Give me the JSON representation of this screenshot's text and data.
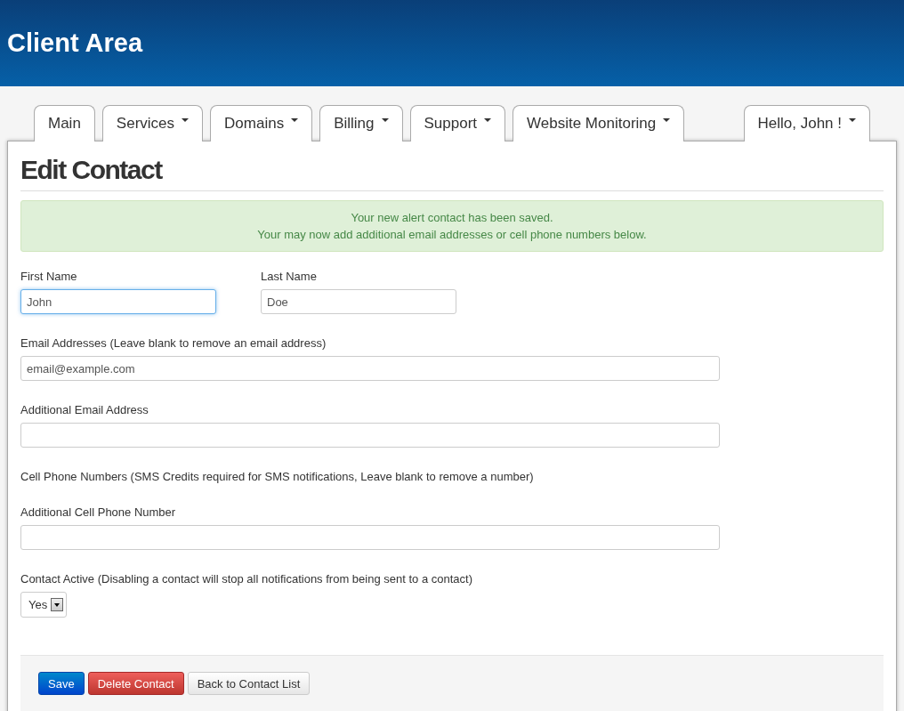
{
  "header": {
    "title": "Client Area"
  },
  "tabs": [
    {
      "label": "Main",
      "dropdown": false
    },
    {
      "label": "Services",
      "dropdown": true
    },
    {
      "label": "Domains",
      "dropdown": true
    },
    {
      "label": "Billing",
      "dropdown": true
    },
    {
      "label": "Support",
      "dropdown": true
    },
    {
      "label": "Website Monitoring",
      "dropdown": true
    }
  ],
  "user_menu": {
    "label": "Hello, John !",
    "dropdown": true
  },
  "page_title": "Edit Contact",
  "alert": {
    "lines": [
      "Your new alert contact has been saved.",
      "Your may now add additional email addresses or cell phone numbers below."
    ]
  },
  "name_fields": [
    {
      "label": "First Name",
      "value": "John",
      "focused": true
    },
    {
      "label": "Last Name",
      "value": "Doe",
      "focused": false
    }
  ],
  "sections": [
    {
      "kind": "field",
      "label": "Email Addresses (Leave blank to remove an email address)",
      "value": "email@example.com"
    },
    {
      "kind": "field",
      "label": "Additional Email Address"
    },
    {
      "kind": "note",
      "label": "Cell Phone Numbers (SMS Credits required for SMS notifications, Leave blank to remove a number)"
    },
    {
      "kind": "field",
      "label": "Additional Cell Phone Number"
    }
  ],
  "active": {
    "label": "Contact Active (Disabling a contact will stop all notifications from being sent to a contact)",
    "value": "Yes"
  },
  "buttons": [
    {
      "label": "Save",
      "kind": "primary"
    },
    {
      "label": "Delete Contact",
      "kind": "danger"
    },
    {
      "label": "Back to Contact List",
      "kind": "default"
    }
  ]
}
